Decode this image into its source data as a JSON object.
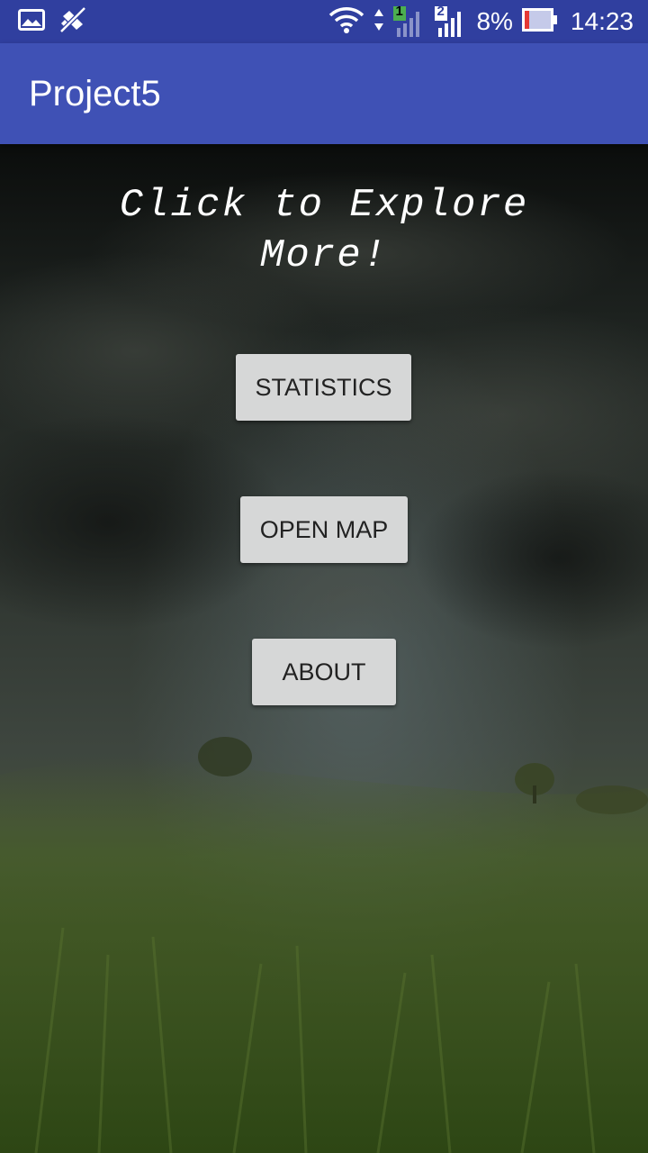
{
  "status_bar": {
    "battery_text": "8%",
    "clock": "14:23",
    "sim1_label": "1",
    "sim2_label": "2",
    "icons": [
      "gallery-icon",
      "mute-icon",
      "wifi-icon",
      "data-arrows-icon",
      "signal-sim1-icon",
      "signal-sim2-icon",
      "battery-icon"
    ]
  },
  "app_bar": {
    "title": "Project5"
  },
  "main": {
    "headline_line1": "Click to Explore",
    "headline_line2": "More!",
    "buttons": {
      "statistics": "STATISTICS",
      "open_map": "OPEN MAP",
      "about": "ABOUT"
    }
  },
  "colors": {
    "status_bar": "#303f9f",
    "app_bar": "#3f51b5",
    "button_bg": "#d6d7d7",
    "battery_low": "#e53935",
    "sim_badge": "#4caf50"
  }
}
